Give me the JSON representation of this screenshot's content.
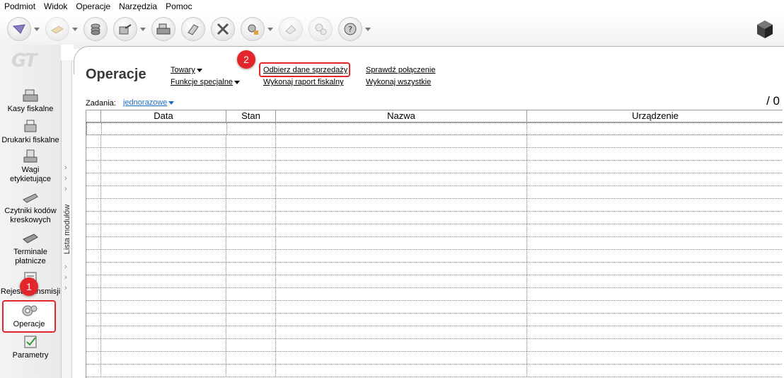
{
  "menu": [
    "Podmiot",
    "Widok",
    "Operacje",
    "Narzędzia",
    "Pomoc"
  ],
  "toolbar": {
    "buttons": [
      {
        "icon": "envelope-icon",
        "dropdown": true,
        "dim": false
      },
      {
        "icon": "forward-icon",
        "dropdown": true,
        "dim": true
      },
      {
        "icon": "coins-icon",
        "dropdown": false,
        "dim": false
      },
      {
        "icon": "export-icon",
        "dropdown": true,
        "dim": false
      },
      {
        "icon": "cash-register-icon",
        "dropdown": false,
        "dim": false
      },
      {
        "icon": "book-icon",
        "dropdown": false,
        "dim": false
      },
      {
        "icon": "tools-icon",
        "dropdown": false,
        "dim": false
      },
      {
        "icon": "settings-icon",
        "dropdown": true,
        "dim": false
      },
      {
        "icon": "eraser-icon",
        "dropdown": false,
        "dim": true
      },
      {
        "icon": "gears-icon",
        "dropdown": false,
        "dim": true
      },
      {
        "icon": "help-icon",
        "dropdown": true,
        "dim": false
      }
    ]
  },
  "sidebar": {
    "logo": "GT",
    "items": [
      {
        "label": "Kasy fiskalne",
        "icon": "cash-register-icon"
      },
      {
        "label": "Drukarki fiskalne",
        "icon": "printer-icon"
      },
      {
        "label": "Wagi etykietujące",
        "icon": "scale-icon"
      },
      {
        "label": "Czytniki kodów kreskowych",
        "icon": "barcode-scanner-icon"
      },
      {
        "label": "Terminale płatnicze",
        "icon": "payment-terminal-icon"
      },
      {
        "label": "Rejestr transmisji",
        "icon": "transmission-log-icon"
      },
      {
        "label": "Operacje",
        "icon": "operations-gear-icon"
      },
      {
        "label": "Parametry",
        "icon": "parameters-icon"
      }
    ],
    "collapse_label": "Lista modułów"
  },
  "page": {
    "title": "Operacje",
    "links": {
      "towary": "Towary",
      "funkcje": "Funkcje specjalne",
      "odbierz": "Odbierz dane sprzedaży",
      "raport": "Wykonaj raport fiskalny",
      "sprawdz": "Sprawdź połączenie",
      "wszystkie": "Wykonaj wszystkie"
    },
    "zadania_label": "Zadania:",
    "zadania_value": "jednorazowe",
    "counter": "/ 0"
  },
  "grid": {
    "columns": [
      "",
      "Data",
      "Stan",
      "Nazwa",
      "Urządzenie"
    ]
  },
  "annotations": {
    "badge1": "1",
    "badge2": "2"
  },
  "colors": {
    "highlight": "#e3262b",
    "link_blue": "#1a6fc4"
  }
}
